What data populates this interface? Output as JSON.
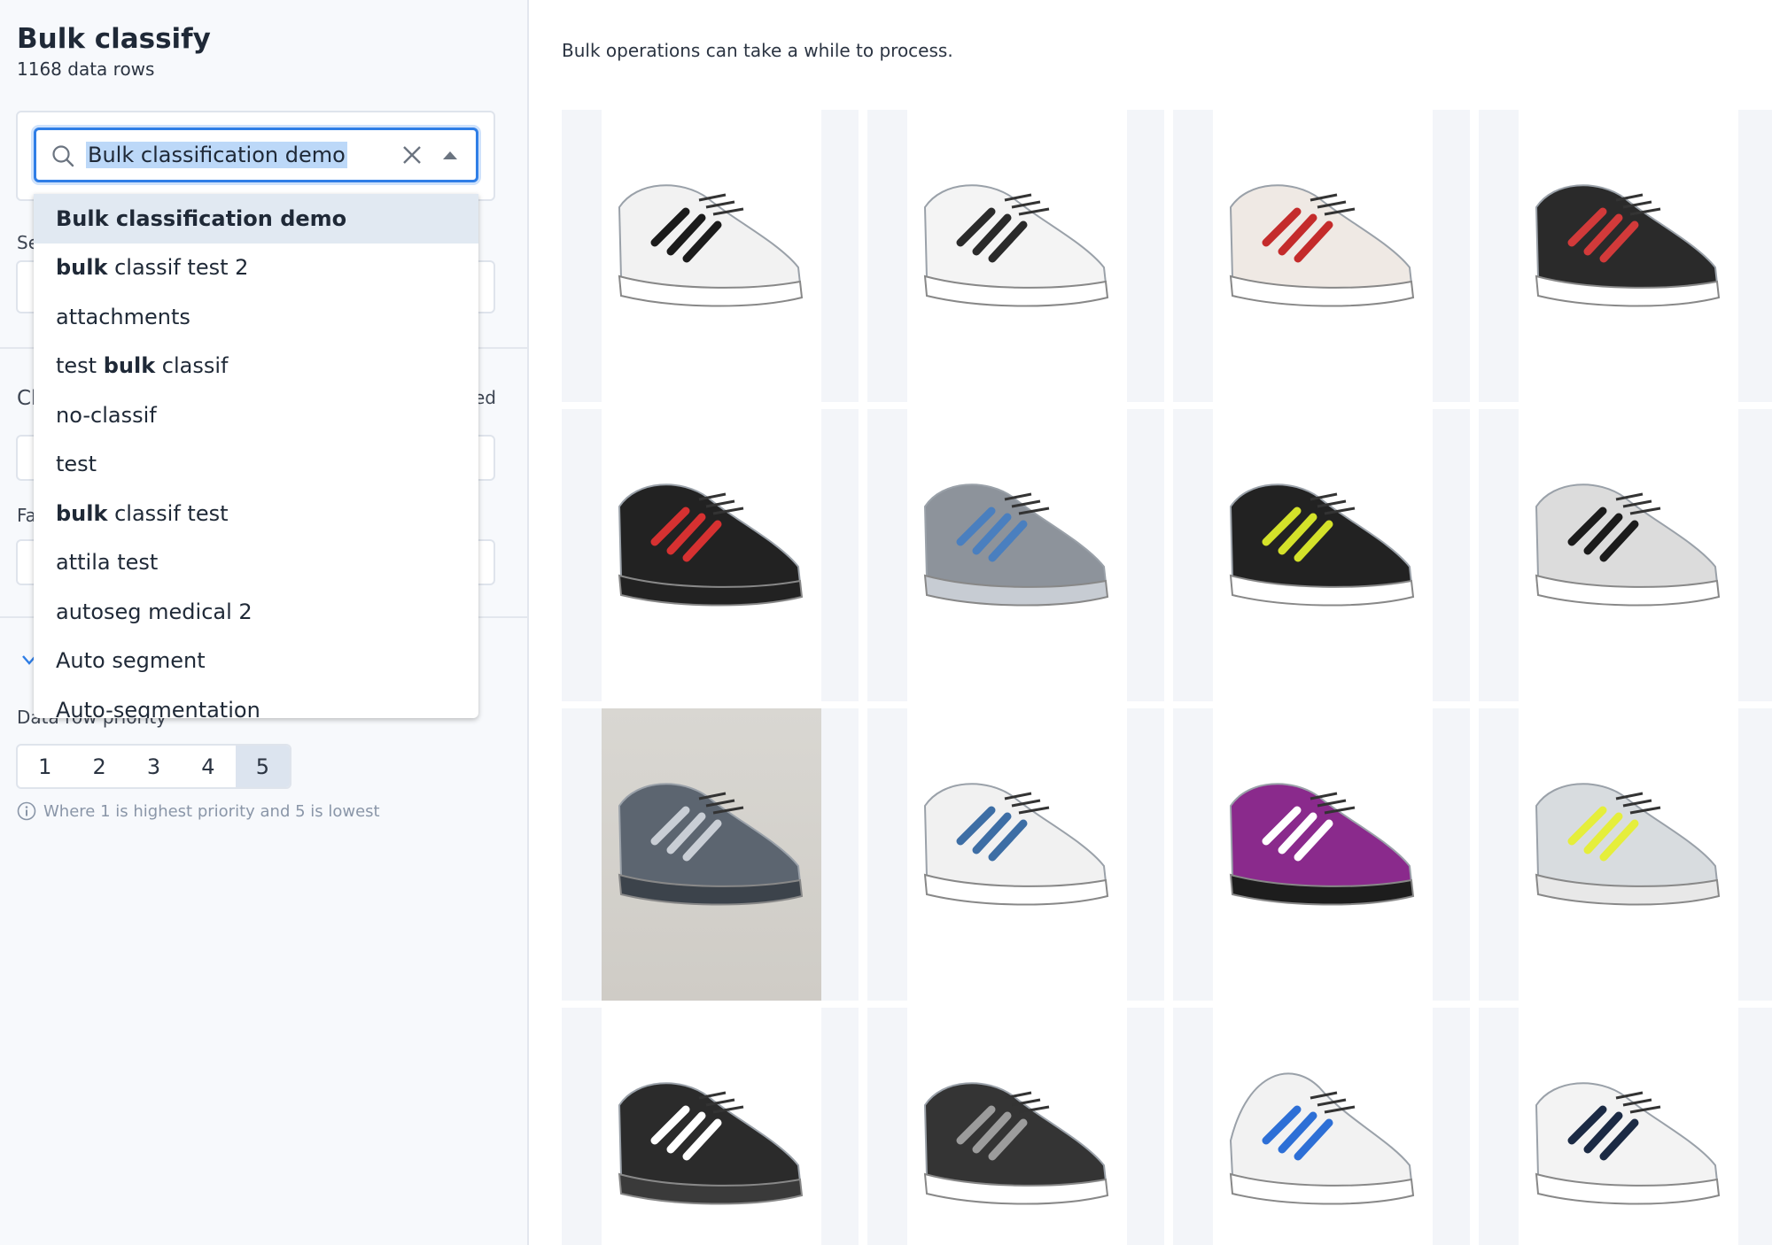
{
  "sidebar": {
    "title": "Bulk classify",
    "row_count": "1168 data rows",
    "dataset_select": {
      "value": "Bulk classification demo"
    },
    "hidden_labels": {
      "se": "Se",
      "cl": "Cl",
      "ed": "ed",
      "fa": "Fa"
    },
    "dropdown_options": [
      {
        "pre": "",
        "bold": "Bulk classification demo",
        "post": "",
        "highlighted": true
      },
      {
        "pre": "",
        "bold": "bulk",
        "post": " classif test 2",
        "highlighted": false
      },
      {
        "pre": "attachments",
        "bold": "",
        "post": "",
        "highlighted": false
      },
      {
        "pre": "test ",
        "bold": "bulk",
        "post": " classif",
        "highlighted": false
      },
      {
        "pre": "no-classif",
        "bold": "",
        "post": "",
        "highlighted": false
      },
      {
        "pre": "test",
        "bold": "",
        "post": "",
        "highlighted": false
      },
      {
        "pre": "",
        "bold": "bulk",
        "post": " classif test",
        "highlighted": false
      },
      {
        "pre": "attila test",
        "bold": "",
        "post": "",
        "highlighted": false
      },
      {
        "pre": "autoseg medical 2",
        "bold": "",
        "post": "",
        "highlighted": false
      },
      {
        "pre": "Auto segment",
        "bold": "",
        "post": "",
        "highlighted": false
      },
      {
        "pre": "Auto-segmentation",
        "bold": "",
        "post": "",
        "highlighted": false
      }
    ],
    "priority": {
      "label": "Data row priority",
      "options": [
        "1",
        "2",
        "3",
        "4",
        "5"
      ],
      "selected": "5",
      "hint": "Where 1 is highest priority and 5 is lowest"
    }
  },
  "main": {
    "notice": "Bulk operations can take a while to process.",
    "images": [
      {
        "icon": "shoe-puma-white-black",
        "body": "#f2f2f2",
        "accent": "#1b1b1b",
        "sole": "#ffffff",
        "bg": "white"
      },
      {
        "icon": "shoe-adidas-white",
        "body": "#f4f4f4",
        "accent": "#2a2a2a",
        "sole": "#ffffff",
        "bg": "white"
      },
      {
        "icon": "shoe-adidas-white-red",
        "body": "#efe9e4",
        "accent": "#c42b2b",
        "sole": "#ffffff",
        "bg": "white"
      },
      {
        "icon": "shoe-adidas-black-red",
        "body": "#2a2a2a",
        "accent": "#d23a3a",
        "sole": "#ffffff",
        "bg": "white"
      },
      {
        "icon": "shoe-adidas-black",
        "body": "#222222",
        "accent": "#d63131",
        "sole": "#222222",
        "bg": "white"
      },
      {
        "icon": "shoe-fila-grey",
        "body": "#8d939b",
        "accent": "#4a7fbf",
        "sole": "#c7ccd3",
        "bg": "white"
      },
      {
        "icon": "shoe-nike-black-volt",
        "body": "#222222",
        "accent": "#d4e22a",
        "sole": "#ffffff",
        "bg": "white"
      },
      {
        "icon": "shoe-puma-silver",
        "body": "#dcdcdc",
        "accent": "#1b1b1b",
        "sole": "#ffffff",
        "bg": "white"
      },
      {
        "icon": "shoe-grey-trail",
        "body": "#5c6570",
        "accent": "#c9ced5",
        "sole": "#3c434b",
        "bg": "gray"
      },
      {
        "icon": "shoe-adidas-white-blue",
        "body": "#f1f1f1",
        "accent": "#3d6ea5",
        "sole": "#ffffff",
        "bg": "white"
      },
      {
        "icon": "shoe-nike-purple",
        "body": "#8a2a8c",
        "accent": "#ffffff",
        "sole": "#1d1d1d",
        "bg": "white"
      },
      {
        "icon": "shoe-yellow-silver",
        "body": "#d8dcdf",
        "accent": "#e5ee3b",
        "sole": "#e8e8e8",
        "bg": "white"
      },
      {
        "icon": "shoe-black-leather",
        "body": "#2b2b2b",
        "accent": "#ffffff",
        "sole": "#3a3a3a",
        "bg": "white"
      },
      {
        "icon": "shoe-adidas-black-mesh",
        "body": "#343434",
        "accent": "#9c9c9c",
        "sole": "#ffffff",
        "bg": "white"
      },
      {
        "icon": "shoe-adidas-hightop-blue",
        "body": "#f2f2f2",
        "accent": "#2d6fd6",
        "sole": "#ffffff",
        "bg": "white"
      },
      {
        "icon": "shoe-nike-white-navy",
        "body": "#f3f3f3",
        "accent": "#1b2a44",
        "sole": "#ffffff",
        "bg": "white"
      }
    ]
  },
  "colors": {
    "accent": "#2f7ee6",
    "highlight": "#bcd8f8",
    "sidebar_bg": "#f7f9fc"
  }
}
